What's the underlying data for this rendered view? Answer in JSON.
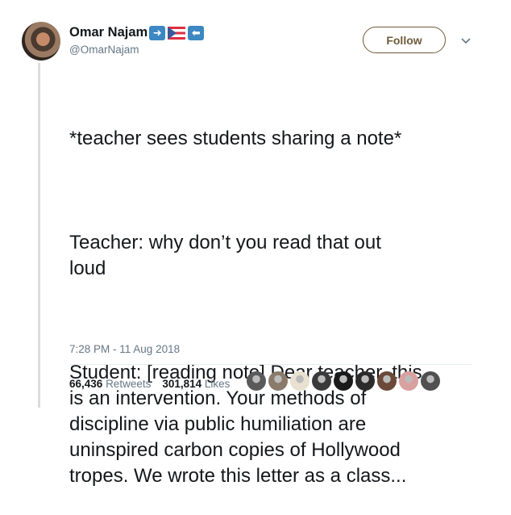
{
  "author": {
    "name": "Omar Najam",
    "handle": "@OmarNajam",
    "name_emoji": [
      "arrow-right-icon",
      "puerto-rico-flag-icon",
      "arrow-left-icon"
    ]
  },
  "follow_label": "Follow",
  "tweet": {
    "paragraphs": [
      "*teacher sees students sharing a note*",
      "Teacher: why don’t you read that out\nloud",
      "Student: [reading note] Dear teacher, this\nis an intervention. Your methods of\ndiscipline via public humiliation are\nuninspired carbon copies of Hollywood\ntropes. We wrote this letter as a class..."
    ],
    "timestamp": "7:28 PM - 11 Aug 2018"
  },
  "stats": {
    "retweets_count": "66,436",
    "retweets_label": "Retweets",
    "likes_count": "301,814",
    "likes_label": "Likes"
  },
  "likers": [
    {
      "color": "#5a5a5a"
    },
    {
      "color": "#8a7a6a"
    },
    {
      "color": "#e8e0d0"
    },
    {
      "color": "#3a3a3a"
    },
    {
      "color": "#1a1a1a"
    },
    {
      "color": "#2b2b2b"
    },
    {
      "color": "#6b4a3a"
    },
    {
      "color": "#d9a0a0"
    },
    {
      "color": "#505050"
    }
  ]
}
